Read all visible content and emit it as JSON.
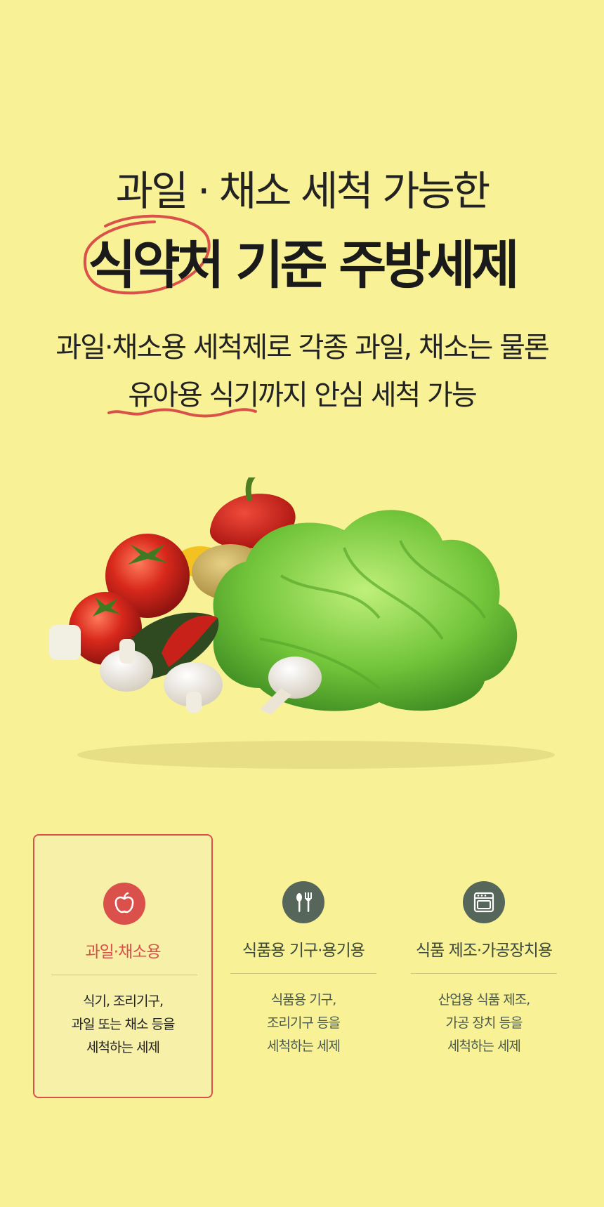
{
  "hero": {
    "line1": "과일 · 채소 세척 가능한",
    "line2": "식약처 기준 주방세제"
  },
  "subtitle": {
    "line1": "과일·채소용 세척제로 각종 과일, 채소는 물론",
    "line2": "유아용 식기까지 안심 세척 가능"
  },
  "colors": {
    "background": "#f8f195",
    "accent_red": "#d9514a",
    "icon_gray": "#56665a"
  },
  "cards": [
    {
      "icon": "apple-icon",
      "title": "과일·채소용",
      "desc": [
        "식기, 조리기구,",
        "과일 또는 채소 등을",
        "세척하는 세제"
      ],
      "active": true
    },
    {
      "icon": "utensils-icon",
      "title": "식품용 기구·용기용",
      "desc": [
        "식품용 기구,",
        "조리기구 등을",
        "세척하는 세제"
      ],
      "active": false
    },
    {
      "icon": "oven-icon",
      "title": "식품 제조·가공장치용",
      "desc": [
        "산업용 식품 제조,",
        "가공 장치 등을",
        "세척하는 세제"
      ],
      "active": false
    }
  ]
}
